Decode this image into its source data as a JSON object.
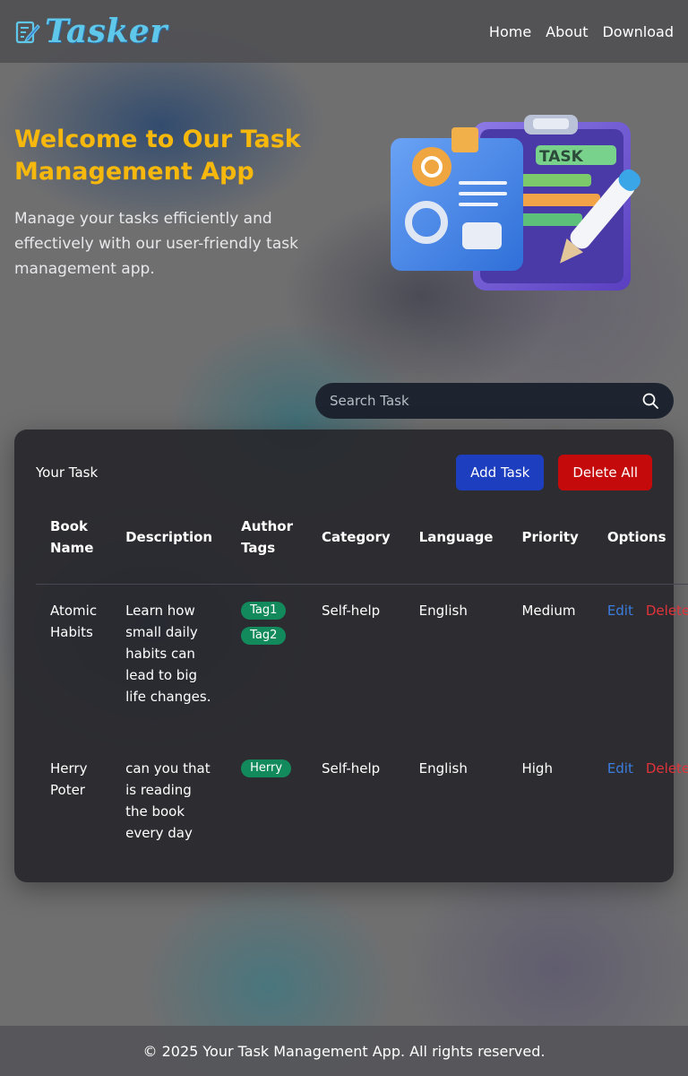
{
  "header": {
    "brand": "Tasker",
    "nav": [
      "Home",
      "About",
      "Download"
    ]
  },
  "hero": {
    "title": "Welcome to Our Task Management App",
    "subtitle": "Manage your tasks efficiently and effectively with our user-friendly task management app.",
    "illustration_label": "TASK"
  },
  "search": {
    "placeholder": "Search Task"
  },
  "task_panel": {
    "title": "Your Task",
    "add_label": "Add Task",
    "delete_all_label": "Delete All",
    "columns": [
      "Book Name",
      "Description",
      "Author Tags",
      "Category",
      "Language",
      "Priority",
      "Options"
    ],
    "rows": [
      {
        "book_name": "Atomic Habits",
        "description": "Learn how small daily habits can lead to big life changes.",
        "tags": [
          "Tag1",
          "Tag2"
        ],
        "category": "Self-help",
        "language": "English",
        "priority": "Medium",
        "edit": "Edit",
        "delete": "Delete"
      },
      {
        "book_name": "Herry Poter",
        "description": "can you that is reading the book every day",
        "tags": [
          "Herry"
        ],
        "category": "Self-help",
        "language": "English",
        "priority": "High",
        "edit": "Edit",
        "delete": "Delete"
      }
    ]
  },
  "footer": {
    "text": "© 2025 Your Task Management App. All rights reserved."
  },
  "colors": {
    "accent_title": "#f6b80c",
    "add_button": "#1d3fbf",
    "delete_button": "#c40a0a",
    "tag": "#128a5c",
    "edit_link": "#3a7de0",
    "delete_link": "#e2333a"
  }
}
